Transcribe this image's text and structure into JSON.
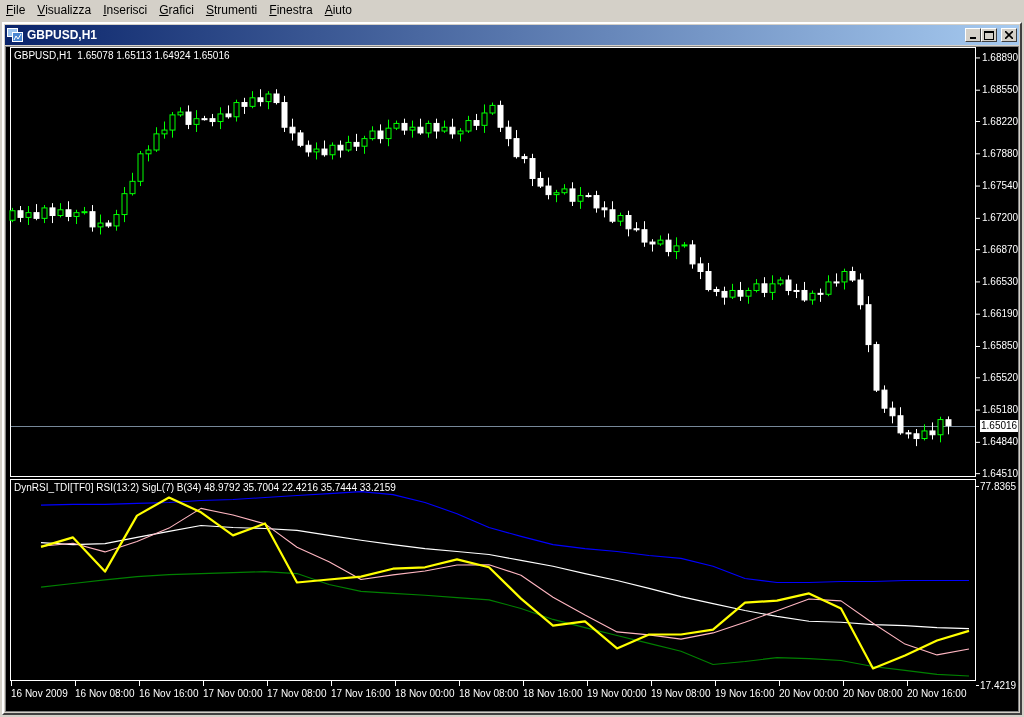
{
  "menu": [
    {
      "label": "File"
    },
    {
      "label": "Visualizza"
    },
    {
      "label": "Inserisci"
    },
    {
      "label": "Grafici"
    },
    {
      "label": "Strumenti"
    },
    {
      "label": "Finestra"
    },
    {
      "label": "Aiuto"
    }
  ],
  "window": {
    "title": "GBPUSD,H1"
  },
  "main_chart": {
    "header": "GBPUSD,H1  1.65078 1.65113 1.64924 1.65016",
    "chart_data": {
      "type": "candlestick",
      "ylim": [
        1.6448,
        1.69
      ],
      "ref_lines": [
        {
          "axis": "y",
          "value": 1.65016,
          "label": "1.65016"
        }
      ],
      "yticks": [
        {
          "value": 1.6889,
          "label": "1.68890"
        },
        {
          "value": 1.6855,
          "label": "1.68550"
        },
        {
          "value": 1.6822,
          "label": "1.68220"
        },
        {
          "value": 1.6788,
          "label": "1.67880"
        },
        {
          "value": 1.6754,
          "label": "1.67540"
        },
        {
          "value": 1.672,
          "label": "1.67200"
        },
        {
          "value": 1.6687,
          "label": "1.66870"
        },
        {
          "value": 1.6653,
          "label": "1.66530"
        },
        {
          "value": 1.6619,
          "label": "1.66190"
        },
        {
          "value": 1.6585,
          "label": "1.65850"
        },
        {
          "value": 1.6552,
          "label": "1.65520"
        },
        {
          "value": 1.6518,
          "label": "1.65180"
        },
        {
          "value": 1.6484,
          "label": "1.64840"
        },
        {
          "value": 1.6451,
          "label": "1.64510"
        }
      ],
      "categories": [
        null,
        null,
        null,
        null,
        null,
        null,
        null,
        null,
        null,
        null,
        null,
        null,
        null,
        null,
        null,
        null,
        null,
        null,
        null,
        null,
        null,
        null,
        null,
        null,
        null,
        null,
        null,
        null,
        null,
        null,
        null,
        null,
        null,
        null,
        null,
        null,
        null,
        null,
        null,
        null,
        null,
        null,
        null,
        null,
        null,
        null,
        null,
        null,
        null,
        null,
        null,
        null,
        null,
        null,
        null,
        null,
        null,
        null,
        null,
        null,
        null,
        null,
        null,
        null,
        null,
        null,
        null,
        null,
        null,
        null,
        null,
        null,
        null,
        null,
        null,
        null,
        null,
        null,
        null,
        null,
        null,
        null,
        null,
        null,
        null,
        null,
        null,
        null,
        null,
        null,
        null,
        null,
        null,
        null,
        null,
        null,
        null,
        null,
        null,
        null,
        null,
        null,
        null,
        null,
        null,
        null,
        null,
        null,
        null,
        null,
        null,
        null,
        null,
        null,
        null,
        null,
        null,
        null
      ],
      "ohlc": [
        [
          1.6718,
          1.6731,
          1.6716,
          1.6728
        ],
        [
          1.6728,
          1.6733,
          1.6716,
          1.6721
        ],
        [
          1.6721,
          1.6733,
          1.6713,
          1.6726
        ],
        [
          1.6726,
          1.6735,
          1.6718,
          1.672
        ],
        [
          1.672,
          1.6734,
          1.6715,
          1.6731
        ],
        [
          1.6731,
          1.6736,
          1.6715,
          1.6723
        ],
        [
          1.6723,
          1.6736,
          1.6721,
          1.6729
        ],
        [
          1.6729,
          1.6738,
          1.6717,
          1.6722
        ],
        [
          1.6722,
          1.6729,
          1.6714,
          1.6726
        ],
        [
          1.6726,
          1.6732,
          1.6724,
          1.6727
        ],
        [
          1.6727,
          1.6734,
          1.6706,
          1.6711
        ],
        [
          1.6711,
          1.6724,
          1.6703,
          1.6715
        ],
        [
          1.6715,
          1.6718,
          1.671,
          1.6712
        ],
        [
          1.6712,
          1.6729,
          1.6707,
          1.6724
        ],
        [
          1.6724,
          1.6753,
          1.6716,
          1.6746
        ],
        [
          1.6746,
          1.6768,
          1.6744,
          1.6759
        ],
        [
          1.6759,
          1.6791,
          1.6754,
          1.6788
        ],
        [
          1.6788,
          1.6797,
          1.678,
          1.6792
        ],
        [
          1.6792,
          1.6816,
          1.679,
          1.6809
        ],
        [
          1.6809,
          1.6822,
          1.6804,
          1.6813
        ],
        [
          1.6813,
          1.6832,
          1.6805,
          1.6829
        ],
        [
          1.6829,
          1.6837,
          1.6827,
          1.6832
        ],
        [
          1.6832,
          1.6839,
          1.6814,
          1.6819
        ],
        [
          1.6819,
          1.6834,
          1.6811,
          1.6825
        ],
        [
          1.6825,
          1.6828,
          1.6823,
          1.6825
        ],
        [
          1.6825,
          1.683,
          1.6817,
          1.6822
        ],
        [
          1.6822,
          1.6837,
          1.6814,
          1.683
        ],
        [
          1.683,
          1.6839,
          1.6825,
          1.6827
        ],
        [
          1.6827,
          1.6845,
          1.6822,
          1.6842
        ],
        [
          1.6842,
          1.6847,
          1.683,
          1.6838
        ],
        [
          1.6838,
          1.6854,
          1.6836,
          1.6847
        ],
        [
          1.6847,
          1.6856,
          1.6838,
          1.6843
        ],
        [
          1.6843,
          1.6854,
          1.6835,
          1.6851
        ],
        [
          1.6851,
          1.6856,
          1.684,
          1.6842
        ],
        [
          1.6842,
          1.6849,
          1.6811,
          1.6816
        ],
        [
          1.6816,
          1.6825,
          1.6802,
          1.681
        ],
        [
          1.681,
          1.6813,
          1.6795,
          1.6797
        ],
        [
          1.6797,
          1.6802,
          1.6785,
          1.679
        ],
        [
          1.679,
          1.68,
          1.6782,
          1.6793
        ],
        [
          1.6793,
          1.6802,
          1.6785,
          1.6787
        ],
        [
          1.6787,
          1.68,
          1.6782,
          1.6797
        ],
        [
          1.6797,
          1.6802,
          1.6784,
          1.6792
        ],
        [
          1.6792,
          1.6807,
          1.679,
          1.68
        ],
        [
          1.68,
          1.6809,
          1.6791,
          1.6796
        ],
        [
          1.6796,
          1.6807,
          1.6788,
          1.6804
        ],
        [
          1.6804,
          1.6817,
          1.6802,
          1.6812
        ],
        [
          1.6812,
          1.6819,
          1.6799,
          1.6804
        ],
        [
          1.6804,
          1.6824,
          1.6796,
          1.6815
        ],
        [
          1.6815,
          1.6823,
          1.6813,
          1.682
        ],
        [
          1.682,
          1.6825,
          1.6808,
          1.6813
        ],
        [
          1.6813,
          1.6823,
          1.6805,
          1.6816
        ],
        [
          1.6816,
          1.6825,
          1.6808,
          1.681
        ],
        [
          1.681,
          1.6823,
          1.6805,
          1.682
        ],
        [
          1.682,
          1.6825,
          1.6804,
          1.6812
        ],
        [
          1.6812,
          1.6823,
          1.681,
          1.6816
        ],
        [
          1.6816,
          1.6825,
          1.6804,
          1.6809
        ],
        [
          1.6809,
          1.6815,
          1.6801,
          1.6812
        ],
        [
          1.6812,
          1.6828,
          1.681,
          1.6823
        ],
        [
          1.6823,
          1.683,
          1.6813,
          1.6818
        ],
        [
          1.6818,
          1.684,
          1.681,
          1.6831
        ],
        [
          1.6831,
          1.6842,
          1.6829,
          1.6839
        ],
        [
          1.6839,
          1.6844,
          1.6811,
          1.6816
        ],
        [
          1.6816,
          1.6823,
          1.6796,
          1.6804
        ],
        [
          1.6804,
          1.6813,
          1.6783,
          1.6785
        ],
        [
          1.6785,
          1.6788,
          1.6778,
          1.6783
        ],
        [
          1.6783,
          1.6788,
          1.6754,
          1.6762
        ],
        [
          1.6762,
          1.6769,
          1.6752,
          1.6754
        ],
        [
          1.6754,
          1.6763,
          1.674,
          1.6745
        ],
        [
          1.6745,
          1.675,
          1.6737,
          1.6747
        ],
        [
          1.6747,
          1.6756,
          1.6745,
          1.6751
        ],
        [
          1.6751,
          1.6758,
          1.6733,
          1.6738
        ],
        [
          1.6738,
          1.6753,
          1.673,
          1.6744
        ],
        [
          1.6744,
          1.6747,
          1.6742,
          1.6744
        ],
        [
          1.6744,
          1.6749,
          1.6726,
          1.6731
        ],
        [
          1.6731,
          1.6738,
          1.6721,
          1.6729
        ],
        [
          1.6729,
          1.6738,
          1.6715,
          1.6717
        ],
        [
          1.6717,
          1.6726,
          1.6712,
          1.6723
        ],
        [
          1.6723,
          1.6728,
          1.6701,
          1.6709
        ],
        [
          1.6709,
          1.6716,
          1.6706,
          1.6708
        ],
        [
          1.6708,
          1.6717,
          1.669,
          1.6695
        ],
        [
          1.6695,
          1.6698,
          1.6685,
          1.6693
        ],
        [
          1.6693,
          1.6702,
          1.6691,
          1.6697
        ],
        [
          1.6697,
          1.6704,
          1.668,
          1.6685
        ],
        [
          1.6685,
          1.67,
          1.6677,
          1.6691
        ],
        [
          1.6691,
          1.6695,
          1.6689,
          1.6692
        ],
        [
          1.6692,
          1.6697,
          1.6667,
          1.6672
        ],
        [
          1.6672,
          1.6679,
          1.6656,
          1.6664
        ],
        [
          1.6664,
          1.6673,
          1.6643,
          1.6645
        ],
        [
          1.6645,
          1.6648,
          1.6638,
          1.6643
        ],
        [
          1.6643,
          1.6648,
          1.6629,
          1.6637
        ],
        [
          1.6637,
          1.6651,
          1.6635,
          1.6644
        ],
        [
          1.6644,
          1.6653,
          1.6633,
          1.6638
        ],
        [
          1.6638,
          1.6647,
          1.663,
          1.6644
        ],
        [
          1.6644,
          1.6656,
          1.6642,
          1.6651
        ],
        [
          1.6651,
          1.6658,
          1.6637,
          1.6642
        ],
        [
          1.6642,
          1.666,
          1.6634,
          1.6651
        ],
        [
          1.6651,
          1.6658,
          1.6649,
          1.6655
        ],
        [
          1.6655,
          1.666,
          1.6639,
          1.6644
        ],
        [
          1.6644,
          1.6651,
          1.6636,
          1.6644
        ],
        [
          1.6644,
          1.6653,
          1.6632,
          1.6634
        ],
        [
          1.6634,
          1.6644,
          1.6629,
          1.6641
        ],
        [
          1.6641,
          1.6646,
          1.6632,
          1.664
        ],
        [
          1.664,
          1.666,
          1.6638,
          1.6653
        ],
        [
          1.6653,
          1.6662,
          1.6648,
          1.6653
        ],
        [
          1.6653,
          1.6667,
          1.6645,
          1.6664
        ],
        [
          1.6664,
          1.6669,
          1.6653,
          1.6655
        ],
        [
          1.6655,
          1.6662,
          1.6624,
          1.6629
        ],
        [
          1.6629,
          1.6638,
          1.6579,
          1.6587
        ],
        [
          1.6587,
          1.659,
          1.6537,
          1.6539
        ],
        [
          1.6539,
          1.6544,
          1.6515,
          1.652
        ],
        [
          1.652,
          1.6527,
          1.6504,
          1.6512
        ],
        [
          1.6512,
          1.6521,
          1.6492,
          1.6494
        ],
        [
          1.6494,
          1.6497,
          1.6488,
          1.6493
        ],
        [
          1.6493,
          1.6498,
          1.648,
          1.6488
        ],
        [
          1.6488,
          1.6503,
          1.6486,
          1.6496
        ],
        [
          1.6496,
          1.6505,
          1.6487,
          1.6492
        ],
        [
          1.6492,
          1.6511,
          1.6484,
          1.6508
        ],
        [
          1.65078,
          1.65113,
          1.64924,
          1.65016
        ]
      ]
    }
  },
  "indicator": {
    "header": "DynRSI_TDI[TF0] RSI(13:2) SigL(7) B(34) 48.9792 35.7004 22.4216 35.7444 33.2159",
    "chart_data": {
      "type": "line",
      "ylim": [
        17.4219,
        79.97
      ],
      "yticks": [
        {
          "value": 77.8365,
          "label": "77.8365"
        },
        {
          "value": 17.4219,
          "label": "17.4219"
        }
      ],
      "categories": [
        "16 Nov 2009",
        null,
        "16 Nov 08:00",
        null,
        "16 Nov 16:00",
        null,
        "17 Nov 00:00",
        null,
        "17 Nov 08:00",
        null,
        "17 Nov 16:00",
        null,
        "18 Nov 00:00",
        null,
        "18 Nov 08:00",
        null,
        "18 Nov 16:00",
        null,
        "19 Nov 00:00",
        null,
        "19 Nov 08:00",
        null,
        "19 Nov 16:00",
        null,
        "20 Nov 00:00",
        null,
        "20 Nov 08:00",
        null,
        "20 Nov 16:00",
        null
      ],
      "series": [
        {
          "color": "#0000ff",
          "values": [
            72.2,
            72.4,
            72.4,
            72.7,
            73.0,
            73.6,
            73.9,
            74.5,
            75.1,
            75.7,
            76.3,
            75.4,
            73.0,
            69.6,
            65.4,
            62.7,
            60.2,
            59.0,
            58.1,
            56.9,
            56.0,
            53.6,
            49.9,
            48.7,
            48.7,
            49.0,
            49.0,
            49.3,
            49.3,
            49.3
          ]
        },
        {
          "color": "#008000",
          "values": [
            47.3,
            48.4,
            49.5,
            50.5,
            51.1,
            51.4,
            51.7,
            52.0,
            51.4,
            48.1,
            46.0,
            45.4,
            44.8,
            44.1,
            43.4,
            40.8,
            37.5,
            35.0,
            32.6,
            30.2,
            27.8,
            23.8,
            24.7,
            25.9,
            25.6,
            25.0,
            23.2,
            22.0,
            20.8,
            20.3
          ]
        },
        {
          "color": "#ffffff",
          "values": [
            60.8,
            60.2,
            60.5,
            62.4,
            64.2,
            66.0,
            65.4,
            65.1,
            64.5,
            63.0,
            61.5,
            60.2,
            59.0,
            58.1,
            57.2,
            55.4,
            53.6,
            51.4,
            49.3,
            46.9,
            44.4,
            42.3,
            40.2,
            38.4,
            36.9,
            36.6,
            35.9,
            35.6,
            35.0,
            34.7
          ]
        },
        {
          "color": "#ffb6c1",
          "values": [
            59.7,
            60.6,
            58.0,
            61.1,
            65.2,
            71.2,
            69.2,
            66.5,
            59.4,
            55.0,
            49.6,
            51.0,
            52.2,
            54.0,
            54.1,
            50.9,
            44.2,
            38.8,
            33.7,
            32.8,
            31.5,
            33.4,
            36.6,
            40.1,
            43.7,
            43.1,
            36.3,
            30.0,
            26.7,
            28.5
          ]
        },
        {
          "color": "#ffff00",
          "values": [
            59.5,
            62.4,
            52.0,
            69.0,
            74.5,
            70.0,
            63.0,
            66.6,
            48.7,
            49.6,
            50.5,
            52.9,
            53.3,
            55.7,
            53.3,
            43.8,
            35.6,
            36.9,
            28.7,
            32.9,
            32.9,
            34.4,
            42.6,
            43.2,
            45.4,
            40.8,
            22.6,
            26.5,
            31.1,
            34.0
          ]
        }
      ]
    }
  }
}
